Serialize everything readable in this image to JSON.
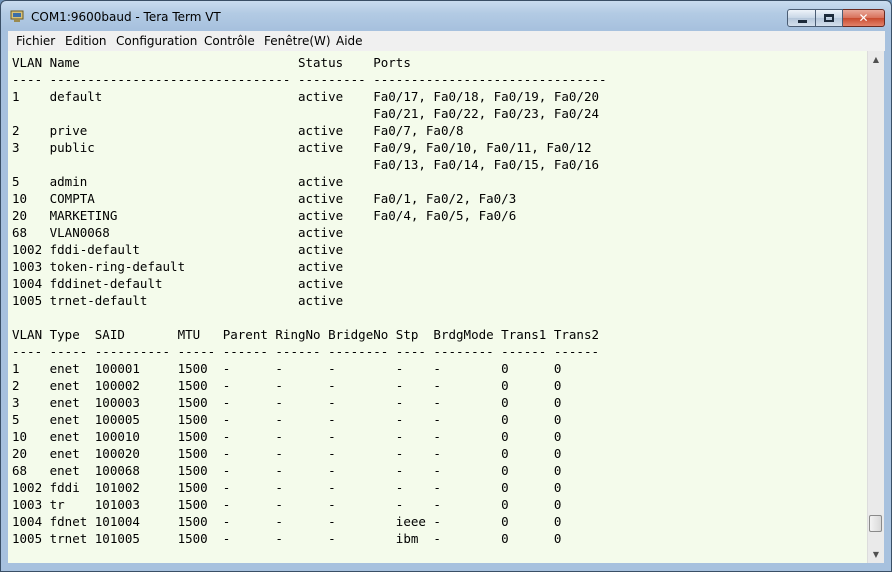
{
  "window": {
    "title": "COM1:9600baud - Tera Term VT",
    "buttons": {
      "close_glyph": "✕"
    }
  },
  "menu": [
    "Fichier",
    "Edition",
    "Configuration",
    "Contrôle",
    "Fenêtre(W)",
    "Aide"
  ],
  "terminal": {
    "lines": [
      "VLAN Name                             Status    Ports",
      "---- -------------------------------- --------- -------------------------------",
      "1    default                          active    Fa0/17, Fa0/18, Fa0/19, Fa0/20",
      "                                                Fa0/21, Fa0/22, Fa0/23, Fa0/24",
      "2    prive                            active    Fa0/7, Fa0/8",
      "3    public                           active    Fa0/9, Fa0/10, Fa0/11, Fa0/12",
      "                                                Fa0/13, Fa0/14, Fa0/15, Fa0/16",
      "5    admin                            active",
      "10   COMPTA                           active    Fa0/1, Fa0/2, Fa0/3",
      "20   MARKETING                        active    Fa0/4, Fa0/5, Fa0/6",
      "68   VLAN0068                         active",
      "1002 fddi-default                     active",
      "1003 token-ring-default               active",
      "1004 fddinet-default                  active",
      "1005 trnet-default                    active",
      "",
      "VLAN Type  SAID       MTU   Parent RingNo BridgeNo Stp  BrdgMode Trans1 Trans2",
      "---- ----- ---------- ----- ------ ------ -------- ---- -------- ------ ------",
      "1    enet  100001     1500  -      -      -        -    -        0      0",
      "2    enet  100002     1500  -      -      -        -    -        0      0",
      "3    enet  100003     1500  -      -      -        -    -        0      0",
      "5    enet  100005     1500  -      -      -        -    -        0      0",
      "10   enet  100010     1500  -      -      -        -    -        0      0",
      "20   enet  100020     1500  -      -      -        -    -        0      0",
      "68   enet  100068     1500  -      -      -        -    -        0      0",
      "1002 fddi  101002     1500  -      -      -        -    -        0      0",
      "1003 tr    101003     1500  -      -      -        -    -        0      0",
      "1004 fdnet 101004     1500  -      -      -        ieee -        0      0",
      "1005 trnet 101005     1500  -      -      -        ibm  -        0      0"
    ]
  },
  "scrollbar": {
    "up_glyph": "▲",
    "down_glyph": "▼"
  }
}
